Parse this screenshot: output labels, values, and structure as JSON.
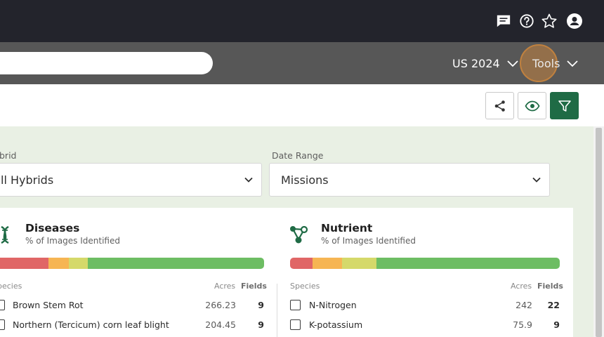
{
  "header": {
    "icons": [
      "feedback-icon",
      "help-icon",
      "star-icon",
      "account-icon"
    ]
  },
  "nav": {
    "search": {
      "value": "",
      "placeholder": ""
    },
    "season_label": "US 2024",
    "tools_label": "Tools"
  },
  "toolbar": {
    "buttons": [
      "share-icon",
      "eye-icon",
      "filter-icon"
    ],
    "accent": "#1f6b45"
  },
  "filters": {
    "hybrid": {
      "label": "brid",
      "value": "ll Hybrids"
    },
    "date_range": {
      "label": "Date Range",
      "value": "Missions"
    }
  },
  "panels": {
    "diseases": {
      "title": "Diseases",
      "subtitle": "% of Images Identified",
      "icon": "dna-icon",
      "bar": [
        {
          "color": "#e06666",
          "fraction": 0.205
        },
        {
          "color": "#f6b553",
          "fraction": 0.075
        },
        {
          "color": "#d5d96a",
          "fraction": 0.07
        },
        {
          "color": "#6dbd63",
          "fraction": 0.65
        }
      ],
      "columns": {
        "species": "pecies",
        "acres": "Acres",
        "fields": "Fields"
      },
      "rows": [
        {
          "name": "Brown Stem Rot",
          "acres": "266.23",
          "fields": "9"
        },
        {
          "name": "Northern (Tercicum) corn leaf blight",
          "acres": "204.45",
          "fields": "9"
        }
      ]
    },
    "nutrient": {
      "title": "Nutrient",
      "subtitle": "% of Images Identified",
      "icon": "molecule-icon",
      "bar": [
        {
          "color": "#e06666",
          "fraction": 0.083
        },
        {
          "color": "#f6b553",
          "fraction": 0.11
        },
        {
          "color": "#d5d96a",
          "fraction": 0.127
        },
        {
          "color": "#6dbd63",
          "fraction": 0.68
        }
      ],
      "columns": {
        "species": "Species",
        "acres": "Acres",
        "fields": "Fields"
      },
      "rows": [
        {
          "name": "N-Nitrogen",
          "acres": "242",
          "fields": "22"
        },
        {
          "name": "K-potassium",
          "acres": "75.9",
          "fields": "9"
        }
      ]
    }
  }
}
